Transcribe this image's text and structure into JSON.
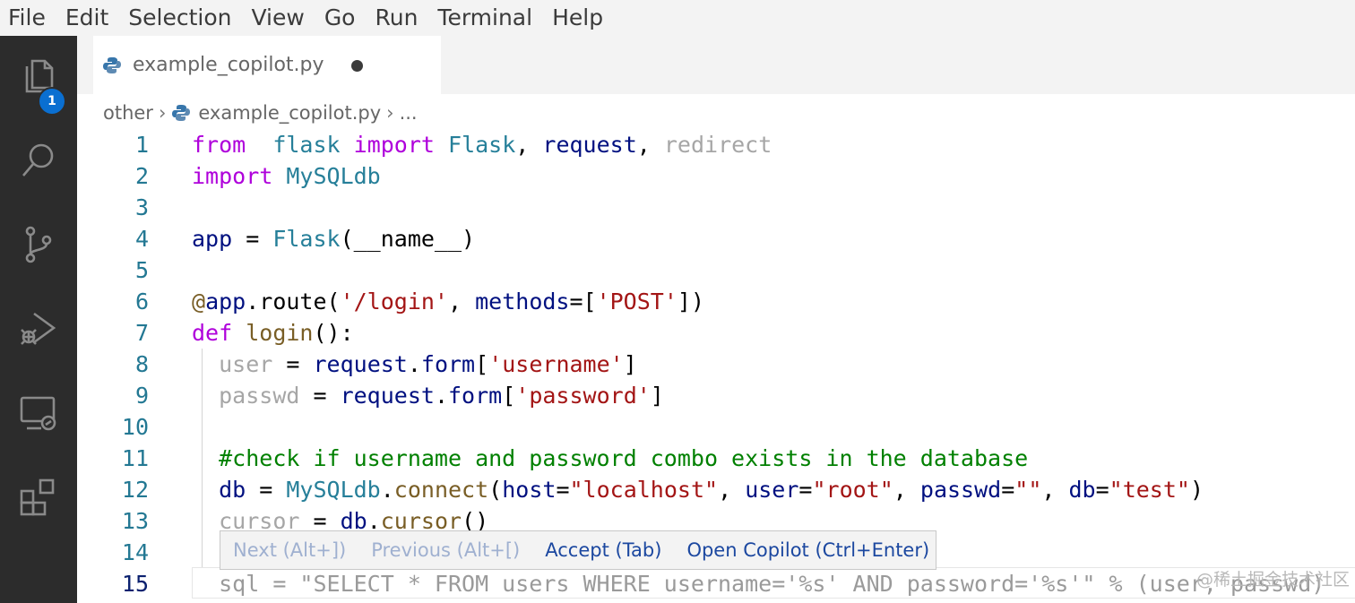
{
  "menubar": {
    "items": [
      "File",
      "Edit",
      "Selection",
      "View",
      "Go",
      "Run",
      "Terminal",
      "Help"
    ]
  },
  "activitybar": {
    "items": [
      "explorer-icon",
      "search-icon",
      "source-control-icon",
      "run-debug-icon",
      "remote-explorer-icon",
      "extensions-icon"
    ],
    "explorer_badge": "1",
    "badge_color": "#0a6fd1"
  },
  "tab": {
    "filename": "example_copilot.py",
    "dirty": true
  },
  "breadcrumb": {
    "folder": "other",
    "file": "example_copilot.py",
    "ellipsis": "..."
  },
  "editor": {
    "active_line": 15,
    "lines": [
      {
        "number": "1",
        "tokens": [
          [
            "kw",
            "from"
          ],
          [
            "",
            "  "
          ],
          [
            "mod",
            "flask"
          ],
          [
            "",
            " "
          ],
          [
            "kw",
            "import"
          ],
          [
            "",
            " "
          ],
          [
            "mod",
            "Flask"
          ],
          [
            "",
            ", "
          ],
          [
            "var",
            "request"
          ],
          [
            "",
            ", "
          ],
          [
            "dim",
            "redirect"
          ]
        ]
      },
      {
        "number": "2",
        "tokens": [
          [
            "kw",
            "import"
          ],
          [
            "",
            " "
          ],
          [
            "mod",
            "MySQLdb"
          ]
        ]
      },
      {
        "number": "3",
        "tokens": []
      },
      {
        "number": "4",
        "tokens": [
          [
            "var",
            "app"
          ],
          [
            "",
            " = "
          ],
          [
            "mod",
            "Flask"
          ],
          [
            "",
            "(__name__)"
          ]
        ]
      },
      {
        "number": "5",
        "tokens": []
      },
      {
        "number": "6",
        "tokens": [
          [
            "dec",
            "@"
          ],
          [
            "var",
            "app"
          ],
          [
            "",
            ".route("
          ],
          [
            "str",
            "'/login'"
          ],
          [
            "",
            ", "
          ],
          [
            "var",
            "methods"
          ],
          [
            "",
            "=["
          ],
          [
            "str",
            "'POST'"
          ],
          [
            "",
            "])"
          ]
        ]
      },
      {
        "number": "7",
        "tokens": [
          [
            "kw",
            "def"
          ],
          [
            "",
            " "
          ],
          [
            "fn",
            "login"
          ],
          [
            "",
            "():"
          ]
        ]
      },
      {
        "number": "8",
        "tokens": [
          [
            "",
            "  "
          ],
          [
            "dim",
            "user"
          ],
          [
            "",
            " = "
          ],
          [
            "var",
            "request"
          ],
          [
            "",
            "."
          ],
          [
            "var",
            "form"
          ],
          [
            "",
            "["
          ],
          [
            "str",
            "'username'"
          ],
          [
            "",
            "]"
          ]
        ]
      },
      {
        "number": "9",
        "tokens": [
          [
            "",
            "  "
          ],
          [
            "dim",
            "passwd"
          ],
          [
            "",
            " = "
          ],
          [
            "var",
            "request"
          ],
          [
            "",
            "."
          ],
          [
            "var",
            "form"
          ],
          [
            "",
            "["
          ],
          [
            "str",
            "'password'"
          ],
          [
            "",
            "]"
          ]
        ]
      },
      {
        "number": "10",
        "tokens": []
      },
      {
        "number": "11",
        "tokens": [
          [
            "",
            "  "
          ],
          [
            "cmt",
            "#check if username and password combo exists in the database"
          ]
        ]
      },
      {
        "number": "12",
        "tokens": [
          [
            "",
            "  "
          ],
          [
            "var",
            "db"
          ],
          [
            "",
            " = "
          ],
          [
            "mod",
            "MySQLdb"
          ],
          [
            "",
            "."
          ],
          [
            "fn",
            "connect"
          ],
          [
            "",
            "("
          ],
          [
            "var",
            "host"
          ],
          [
            "",
            "="
          ],
          [
            "str",
            "\"localhost\""
          ],
          [
            "",
            ", "
          ],
          [
            "var",
            "user"
          ],
          [
            "",
            "="
          ],
          [
            "str",
            "\"root\""
          ],
          [
            "",
            ", "
          ],
          [
            "var",
            "passwd"
          ],
          [
            "",
            "="
          ],
          [
            "str",
            "\"\""
          ],
          [
            "",
            ", "
          ],
          [
            "var",
            "db"
          ],
          [
            "",
            "="
          ],
          [
            "str",
            "\"test\""
          ],
          [
            "",
            ")"
          ]
        ]
      },
      {
        "number": "13",
        "tokens": [
          [
            "",
            "  "
          ],
          [
            "dim",
            "cursor"
          ],
          [
            "",
            " = "
          ],
          [
            "var",
            "db"
          ],
          [
            "",
            "."
          ],
          [
            "fn",
            "cursor"
          ],
          [
            "",
            "()"
          ]
        ]
      },
      {
        "number": "14",
        "tokens": []
      },
      {
        "number": "15",
        "tokens": [
          [
            "",
            "  "
          ],
          [
            "ghost",
            "sql = \"SELECT * FROM users WHERE username='%s' AND password='%s'\" % (user, passwd)"
          ]
        ]
      }
    ]
  },
  "copilot_bar": {
    "next": "Next (Alt+])",
    "previous": "Previous (Alt+[)",
    "accept": "Accept (Tab)",
    "open": "Open Copilot (Ctrl+Enter)"
  },
  "watermark": "@稀土掘金技术社区"
}
